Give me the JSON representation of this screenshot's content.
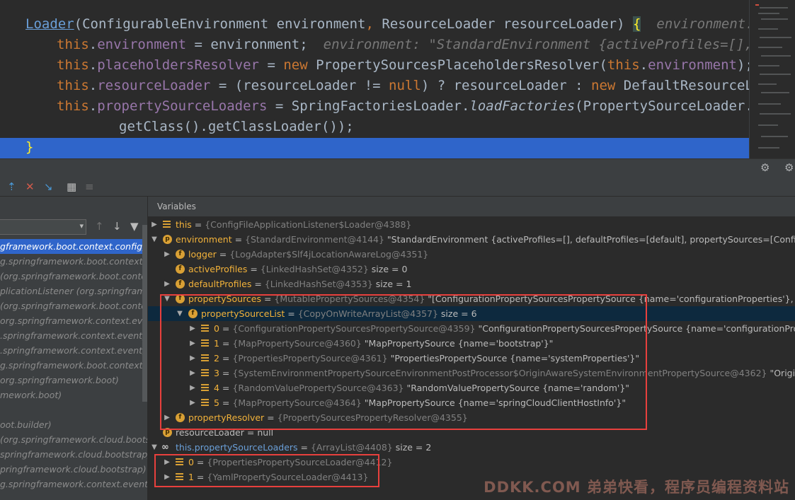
{
  "editor": {
    "lines": [
      {
        "c1": "Loader",
        "c2": "(ConfigurableEnvironment environment",
        "c3": ", ",
        "c4": "ResourceLoader resourceLoader) ",
        "c5": "{",
        "hint": "environment: \"S"
      },
      {
        "kw": "this",
        "dot": ".",
        "field": "environment",
        "rest": " = environment;",
        "hint": "environment: \"StandardEnvironment {activeProfiles=[], de"
      },
      {
        "kw": "this",
        "dot": ".",
        "field": "placeholdersResolver",
        "mid": " = ",
        "new": "new",
        "rest": " PropertySourcesPlaceholdersResolver(",
        "kw2": "this",
        "dot2": ".",
        "field2": "environment",
        "rest2": ");",
        "hint": "p"
      },
      {
        "kw": "this",
        "dot": ".",
        "field": "resourceLoader",
        "mid": " = (resourceLoader != ",
        "null": "null",
        "rest": ") ? resourceLoader : ",
        "new": "new",
        "rest2": " DefaultResourceLoad"
      },
      {
        "kw": "this",
        "dot": ".",
        "field": "propertySourceLoaders",
        "mid": " = SpringFactoriesLoader.",
        "ital": "loadFactories",
        "rest": "(PropertySourceLoader.",
        "kw2": "cla"
      },
      {
        "rest": "getClass().getClassLoader());"
      },
      {
        "rest": "}"
      }
    ]
  },
  "variables_title": "Variables",
  "frames": [
    {
      "text": "gframework.boot.context.config)",
      "selected": true
    },
    {
      "text": "g.springframework.boot.context.co",
      "selected": false
    },
    {
      "text": " (org.springframework.boot.context",
      "selected": false
    },
    {
      "text": "plicationListener  (org.springframew",
      "selected": false
    },
    {
      "text": " (org.springframework.boot.context.confi",
      "selected": false
    },
    {
      "text": "org.springframework.context.event)",
      "selected": false
    },
    {
      "text": ".springframework.context.event)",
      "selected": false
    },
    {
      "text": ".springframework.context.event)",
      "selected": false
    },
    {
      "text": "g.springframework.boot.context.event",
      "selected": false
    },
    {
      "text": "org.springframework.boot)",
      "selected": false
    },
    {
      "text": "mework.boot)",
      "selected": false
    },
    {
      "text": "",
      "selected": false
    },
    {
      "text": "oot.builder)",
      "selected": false
    },
    {
      "text": " (org.springframework.cloud.bootst",
      "selected": false
    },
    {
      "text": "springframework.cloud.bootstrap)",
      "selected": false
    },
    {
      "text": "pringframework.cloud.bootstrap)",
      "selected": false
    },
    {
      "text": "g.springframework.context.event",
      "selected": false
    }
  ],
  "variables": [
    {
      "name": "this",
      "eq": " = ",
      "ref": "{ConfigFileApplicationListener$Loader@4388}",
      "val": ""
    },
    {
      "name": "environment",
      "eq": " = ",
      "ref": "{StandardEnvironment@4144}",
      "val": " \"StandardEnvironment {activeProfiles=[], defaultProfiles=[default], propertySources=[ConfigurationProp"
    },
    {
      "name": "logger",
      "eq": " = ",
      "ref": "{LogAdapter$Slf4jLocationAwareLog@4351}",
      "val": ""
    },
    {
      "name": "activeProfiles",
      "eq": " = ",
      "ref": "{LinkedHashSet@4352}",
      "val": "  size = 0"
    },
    {
      "name": "defaultProfiles",
      "eq": " = ",
      "ref": "{LinkedHashSet@4353}",
      "val": "  size = 1"
    },
    {
      "name": "propertySources",
      "eq": " = ",
      "ref": "{MutablePropertySources@4354}",
      "val": " \"[ConfigurationPropertySourcesPropertySource {name='configurationProperties'}, MapPrope"
    },
    {
      "name": "propertySourceList",
      "eq": " = ",
      "ref": "{CopyOnWriteArrayList@4357}",
      "val": "  size = 6"
    },
    {
      "name": "0",
      "eq": " = ",
      "ref": "{ConfigurationPropertySourcesPropertySource@4359}",
      "val": " \"ConfigurationPropertySourcesPropertySource {name='configurationProperties'}\""
    },
    {
      "name": "1",
      "eq": " = ",
      "ref": "{MapPropertySource@4360}",
      "val": " \"MapPropertySource {name='bootstrap'}\""
    },
    {
      "name": "2",
      "eq": " = ",
      "ref": "{PropertiesPropertySource@4361}",
      "val": " \"PropertiesPropertySource {name='systemProperties'}\""
    },
    {
      "name": "3",
      "eq": " = ",
      "ref": "{SystemEnvironmentPropertySourceEnvironmentPostProcessor$OriginAwareSystemEnvironmentPropertySource@4362}",
      "val": " \"OriginAwareSy"
    },
    {
      "name": "4",
      "eq": " = ",
      "ref": "{RandomValuePropertySource@4363}",
      "val": " \"RandomValuePropertySource {name='random'}\""
    },
    {
      "name": "5",
      "eq": " = ",
      "ref": "{MapPropertySource@4364}",
      "val": " \"MapPropertySource {name='springCloudClientHostInfo'}\""
    },
    {
      "name": "propertyResolver",
      "eq": " = ",
      "ref": "{PropertySourcesPropertyResolver@4355}",
      "val": ""
    },
    {
      "name": "resourceLoader",
      "eq": " = ",
      "ref": "",
      "val": "null"
    },
    {
      "name": "this.propertySourceLoaders",
      "eq": " = ",
      "ref": "{ArrayList@4408}",
      "val": "  size = 2"
    },
    {
      "name": "0",
      "eq": " = ",
      "ref": "{PropertiesPropertySourceLoader@4412}",
      "val": ""
    },
    {
      "name": "1",
      "eq": " = ",
      "ref": "{YamlPropertySourceLoader@4413}",
      "val": ""
    }
  ],
  "watermark": "DDKK.COM 弟弟快看，程序员编程资料站",
  "colors": {
    "accent": "#2f65ca",
    "highlight_box": "#e8403d",
    "var_name": "#f2b23a"
  }
}
